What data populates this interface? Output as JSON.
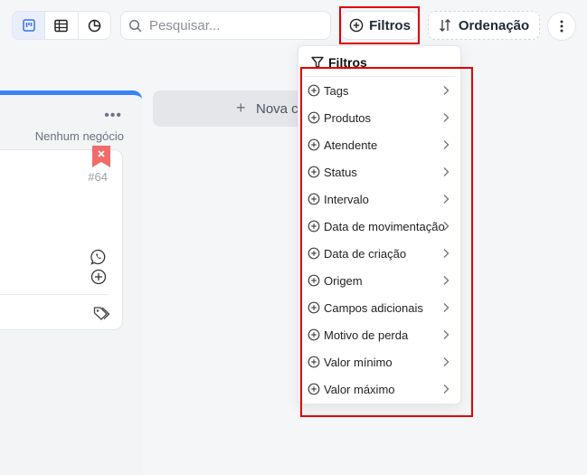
{
  "toolbar": {
    "search_placeholder": "Pesquisar...",
    "filter_label": "Filtros",
    "order_label": "Ordenação"
  },
  "column": {
    "empty_text": "Nenhum negócio",
    "card_id": "#64"
  },
  "new_column_label": "Nova c",
  "filter_menu": {
    "title": "Filtros",
    "items": [
      "Tags",
      "Produtos",
      "Atendente",
      "Status",
      "Intervalo",
      "Data de movimentação",
      "Data de criação",
      "Origem",
      "Campos adicionais",
      "Motivo de perda",
      "Valor mínimo",
      "Valor máximo"
    ]
  },
  "colors": {
    "accent": "#3b82f6",
    "highlight": "#e00000",
    "bookmark": "#f26b6b"
  },
  "icons": {
    "view_modes": [
      "kanban-icon",
      "table-icon",
      "pie-chart-icon"
    ],
    "search": "search-icon",
    "filter_button": "plus-circle-icon",
    "order": "sort-arrows-icon",
    "more": "more-vertical-icon",
    "menu_item": "plus-circle-icon",
    "submenu": "chevron-right-icon"
  }
}
